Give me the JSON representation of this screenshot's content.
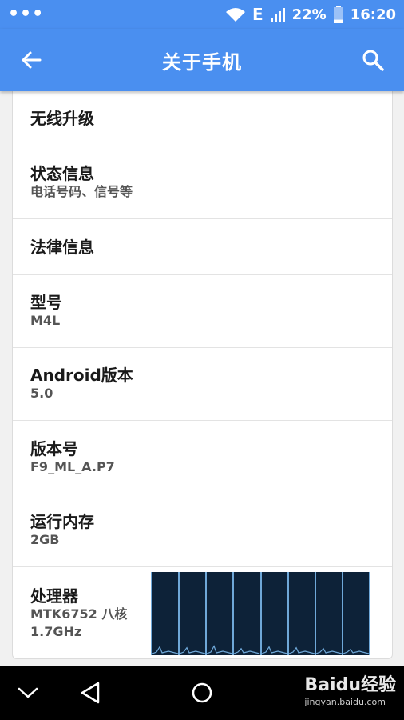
{
  "status_bar": {
    "network": "E",
    "battery_percent": "22%",
    "time": "16:20",
    "battery_level": 0.22
  },
  "app_bar": {
    "title": "关于手机",
    "back_icon": "arrow-back-icon",
    "search_icon": "search-icon"
  },
  "items": [
    {
      "title": "无线升级",
      "summary": ""
    },
    {
      "title": "状态信息",
      "summary": "电话号码、信号等"
    },
    {
      "title": "法律信息",
      "summary": ""
    },
    {
      "title": "型号",
      "summary": "M4L"
    },
    {
      "title": "Android版本",
      "summary": "5.0"
    },
    {
      "title": "版本号",
      "summary": "F9_ML_A.P7"
    },
    {
      "title": "运行内存",
      "summary": "2GB"
    },
    {
      "title": "处理器",
      "summary": "MTK6752 八核\n1.7GHz"
    }
  ],
  "cpu_graph": {
    "cores": 8,
    "load": [
      0.08,
      0.07,
      0.09,
      0.06,
      0.08,
      0.07,
      0.06,
      0.05
    ]
  },
  "nav_bar": {
    "hide_icon": "chevron-down-icon",
    "back_icon": "triangle-back-icon",
    "home_icon": "circle-home-icon"
  },
  "watermark": {
    "text": "Baidu经验",
    "sub": "jingyan.baidu.com"
  },
  "colors": {
    "primary": "#4a8ff0",
    "graph_bg": "#0d2238",
    "graph_line": "#6fa8d8"
  }
}
